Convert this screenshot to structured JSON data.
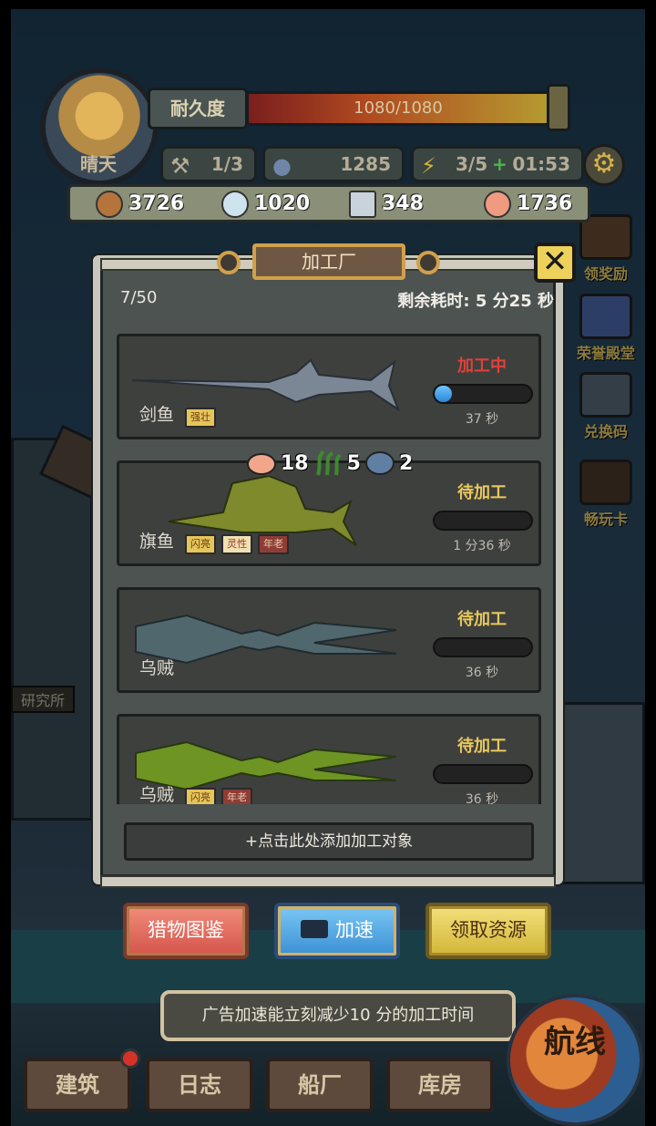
{
  "hud": {
    "weather": "晴天",
    "durability_label": "耐久度",
    "durability_value": "1080/1080",
    "workers": "1/3",
    "fish_count": "1285",
    "energy": "3/5",
    "energy_timer": "01:53"
  },
  "resources": [
    {
      "icon": "wood-icon",
      "value": "3726",
      "color": "#b5743b"
    },
    {
      "icon": "ice-icon",
      "value": "1020",
      "color": "#cfe3ef"
    },
    {
      "icon": "metal-icon",
      "value": "348",
      "color": "#c9d3dc"
    },
    {
      "icon": "fish-meat-icon",
      "value": "1736",
      "color": "#f09a80"
    }
  ],
  "side_menu": [
    "领奖励",
    "荣誉殿堂",
    "兑换码",
    "畅玩卡"
  ],
  "bg_labels": {
    "research": "研究所"
  },
  "panel": {
    "title": "加工厂",
    "close": "✕",
    "count": "7/50",
    "remaining": "剩余耗时: 5 分25 秒",
    "items": [
      {
        "name": "剑鱼",
        "tags": [
          "强壮"
        ],
        "status": "加工中",
        "progress": 0.1,
        "time": "37 秒"
      },
      {
        "name": "旗鱼",
        "tags": [
          "闪亮",
          "灵性",
          "年老"
        ],
        "status": "待加工",
        "progress": 0,
        "time": "1 分36 秒"
      },
      {
        "name": "乌贼",
        "tags": [],
        "status": "待加工",
        "progress": 0,
        "time": "36 秒"
      },
      {
        "name": "乌贼",
        "tags": [
          "闪亮",
          "年老"
        ],
        "status": "待加工",
        "progress": 0,
        "time": "36 秒"
      }
    ],
    "reward": {
      "meat": "18",
      "seaweed": "5",
      "scales": "2"
    },
    "add_target": "+点击此处添加加工对象"
  },
  "buttons": {
    "catalog": "猎物图鉴",
    "speed": "加速",
    "collect": "领取资源"
  },
  "ad_tip": "广告加速能立刻减少10 分的加工时间",
  "nav": {
    "build": "建筑",
    "log": "日志",
    "shipyard": "船厂",
    "warehouse": "库房",
    "route": "航线"
  }
}
